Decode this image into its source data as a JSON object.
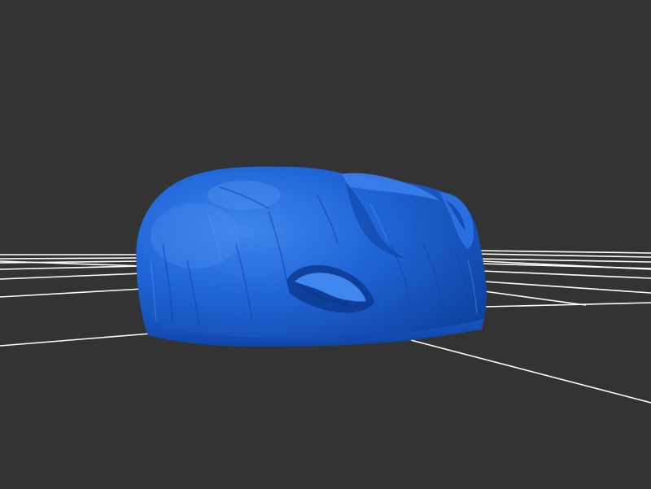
{
  "viewer": {
    "background_color": "#333333",
    "grid_color": "#ffffff",
    "model_color": "#1f64d6",
    "model_shadow_color": "#0b3a8f",
    "model_highlight_color": "#4d8ef0",
    "grid_visible": true
  }
}
